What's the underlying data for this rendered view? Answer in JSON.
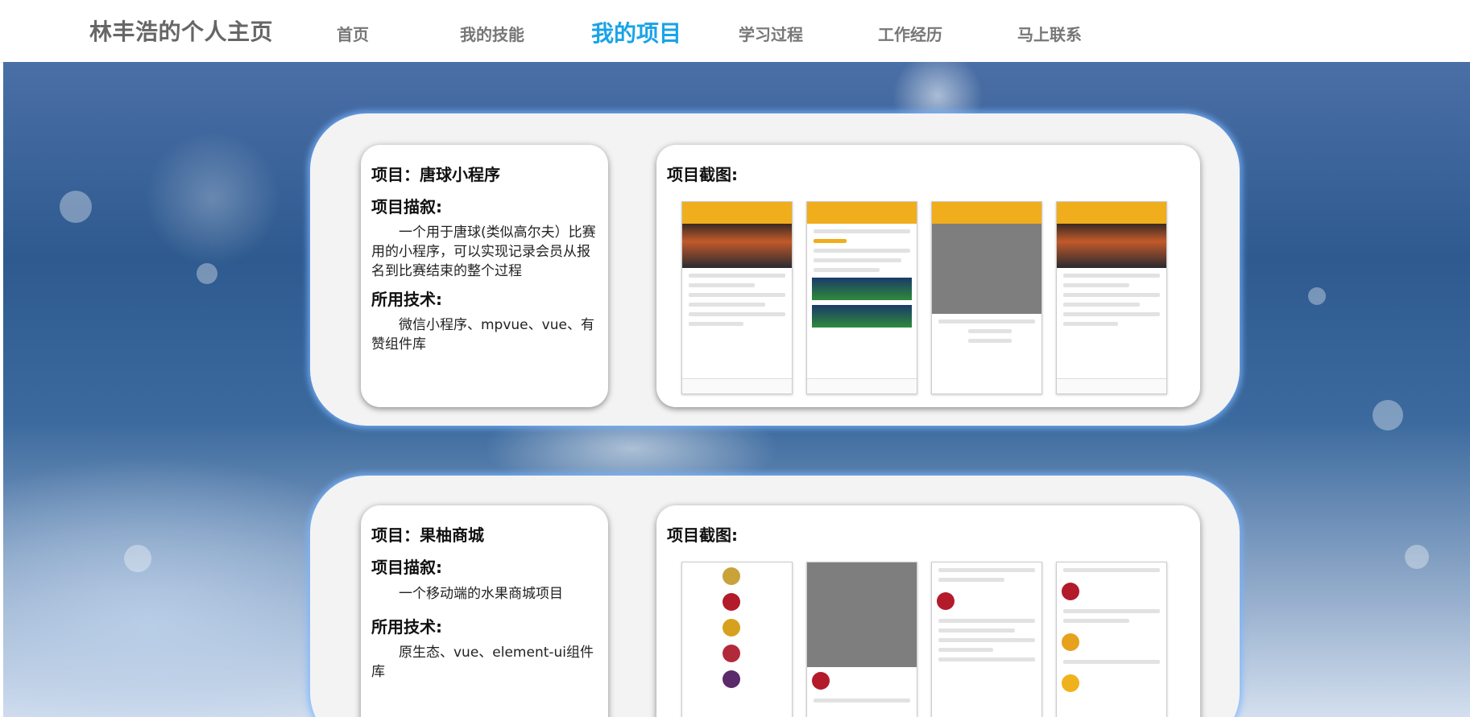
{
  "header": {
    "logo": "林丰浩的个人主页",
    "nav": [
      {
        "label": "首页"
      },
      {
        "label": "我的技能"
      },
      {
        "label": "我的项目"
      },
      {
        "label": "学习过程"
      },
      {
        "label": "工作经历"
      },
      {
        "label": "马上联系"
      }
    ],
    "active_index": 2,
    "active_color": "#1aa3e8"
  },
  "projects": [
    {
      "name_heading": "项目：唐球小程序",
      "desc_heading": "项目描叙:",
      "desc": "一个用于唐球(类似高尔夫）比赛用的小程序，可以实现记录会员从报名到比赛结束的整个过程",
      "tech_heading": "所用技术:",
      "tech": "微信小程序、mpvue、vue、有赞组件库",
      "shots_heading": "项目截图:"
    },
    {
      "name_heading": "项目：果柚商城",
      "desc_heading": "项目描叙:",
      "desc": "一个移动端的水果商城项目",
      "tech_heading": "所用技术:",
      "tech": "原生态、vue、element-ui组件库",
      "shots_heading": "项目截图:"
    }
  ]
}
